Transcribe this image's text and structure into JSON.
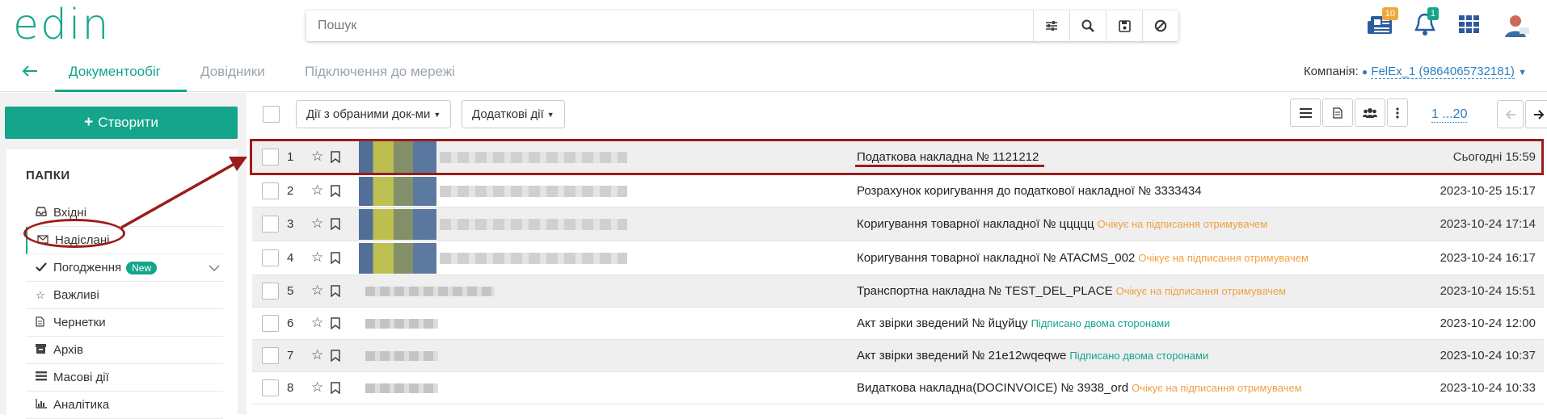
{
  "header": {
    "logo": "edin",
    "search_placeholder": "Пошук",
    "news_badge": "10",
    "notif_badge": "1"
  },
  "nav": {
    "tabs": [
      {
        "label": "Документообіг"
      },
      {
        "label": "Довідники"
      },
      {
        "label": "Підключення до мережі"
      }
    ],
    "company_label": "Компанія:",
    "company_value": "FelEx_1 (9864065732181)"
  },
  "sidebar": {
    "create_label": "Створити",
    "folders_title": "ПАПКИ",
    "items": [
      {
        "label": "Вхідні",
        "icon": "inbox-icon"
      },
      {
        "label": "Надіслані",
        "icon": "envelope-icon"
      },
      {
        "label": "Погодження",
        "icon": "check-icon",
        "badge": "New"
      },
      {
        "label": "Важливі",
        "icon": "star-icon"
      },
      {
        "label": "Чернетки",
        "icon": "draft-icon"
      },
      {
        "label": "Архів",
        "icon": "archive-icon"
      },
      {
        "label": "Масові дії",
        "icon": "bulk-icon"
      },
      {
        "label": "Аналітика",
        "icon": "chart-icon"
      }
    ]
  },
  "toolbar": {
    "selected_actions": "Дії з обраними док-ми",
    "extra_actions": "Додаткові дії",
    "pager": "1 ...20"
  },
  "rows": [
    {
      "num": "1",
      "doc": "Податкова накладна № 1121212",
      "status": "",
      "date": "Сьогодні 15:59"
    },
    {
      "num": "2",
      "doc": "Розрахунок коригування до податкової накладної № 3333434",
      "status": "",
      "date": "2023-10-25 15:17"
    },
    {
      "num": "3",
      "doc": "Коригування товарної накладної № ццццц",
      "status": "Очікує на підписання отримувачем",
      "date": "2023-10-24 17:14"
    },
    {
      "num": "4",
      "doc": "Коригування товарної накладної № ATACMS_002",
      "status": "Очікує на підписання отримувачем",
      "date": "2023-10-24 16:17"
    },
    {
      "num": "5",
      "doc": "Транспортна накладна № TEST_DEL_PLACE",
      "status": "Очікує на підписання отримувачем",
      "date": "2023-10-24 15:51"
    },
    {
      "num": "6",
      "doc": "Акт звірки зведений № йцуйцу",
      "status": "Підписано двома сторонами",
      "date": "2023-10-24 12:00"
    },
    {
      "num": "7",
      "doc": "Акт звірки зведений № 21e12wqeqwe",
      "status": "Підписано двома сторонами",
      "date": "2023-10-24 10:37"
    },
    {
      "num": "8",
      "doc": "Видаткова накладна(DOCINVOICE) № 3938_ord",
      "status": "Очікує на підписання отримувачем",
      "date": "2023-10-24 10:33"
    }
  ],
  "colors": {
    "accent": "#14a58a",
    "annotation": "#9b1c1c",
    "pending": "#f0a040",
    "link": "#2c7fc2"
  }
}
